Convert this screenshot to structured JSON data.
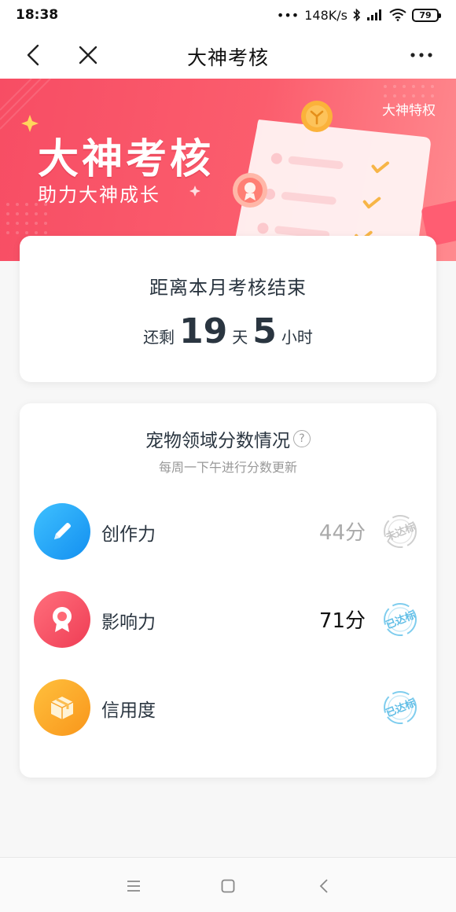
{
  "status_bar": {
    "time": "18:38",
    "network_speed": "148K/s",
    "battery": "79"
  },
  "nav": {
    "title": "大神考核"
  },
  "banner": {
    "title": "大神考核",
    "subtitle": "助力大神成长",
    "tag": "大神特权"
  },
  "countdown": {
    "label": "距离本月考核结束",
    "prefix": "还剩",
    "days": "19",
    "day_unit": "天",
    "hours": "5",
    "hour_unit": "小时"
  },
  "scores": {
    "title": "宠物领域分数情况",
    "help_symbol": "?",
    "subtitle": "每周一下午进行分数更新",
    "items": [
      {
        "label": "创作力",
        "score": "44分",
        "badge": "未达标",
        "icon": "pencil-icon",
        "color": "#1da1f2",
        "score_color": "#aaaaaa",
        "badge_color": "#c8c8c8"
      },
      {
        "label": "影响力",
        "score": "71分",
        "badge": "已达标",
        "icon": "medal-icon",
        "color": "#f44f61",
        "score_color": "#111111",
        "badge_color": "#6ec6ea"
      },
      {
        "label": "信用度",
        "score": "",
        "badge": "已达标",
        "icon": "box-icon",
        "color": "#fbab22",
        "score_color": "#111111",
        "badge_color": "#6ec6ea"
      }
    ]
  }
}
